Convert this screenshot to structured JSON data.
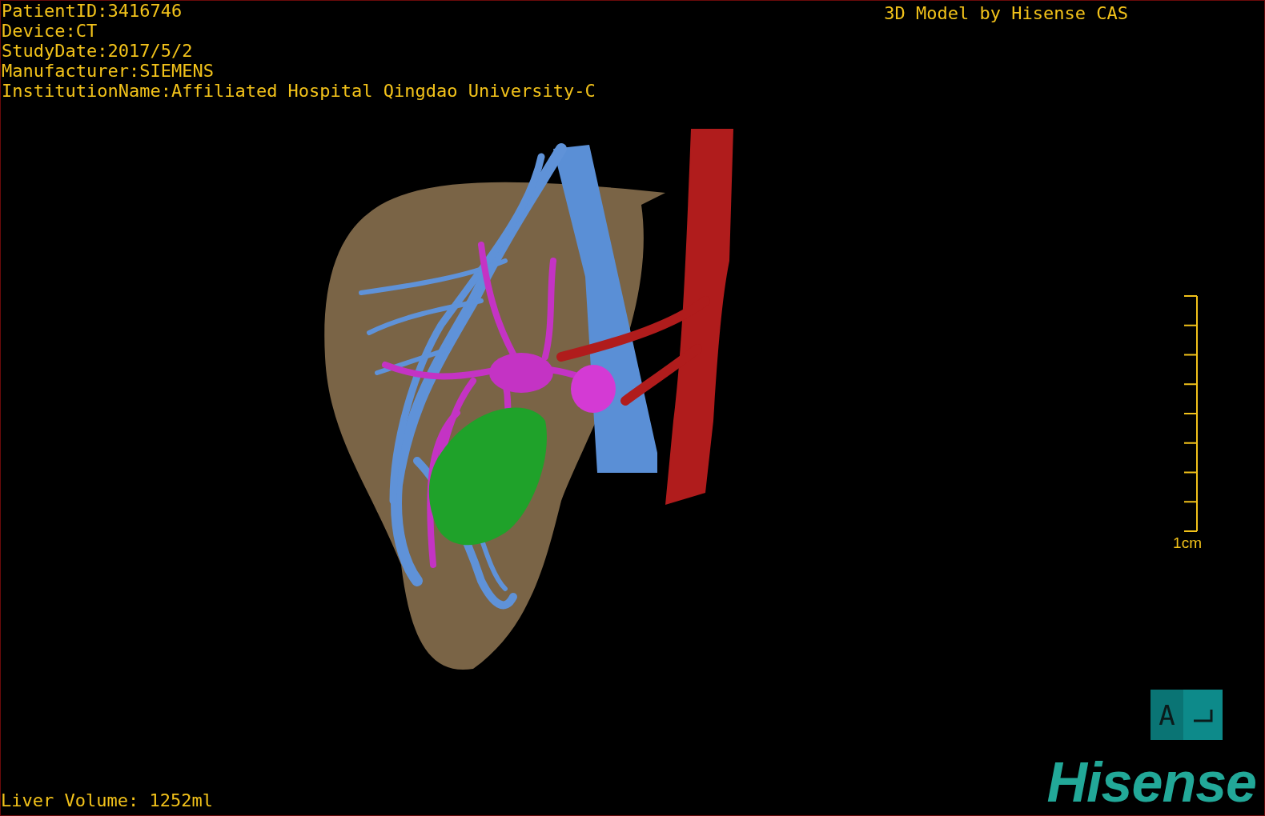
{
  "study_info": [
    "PatientID:3416746",
    "Device:CT",
    "StudyDate:2017/5/2",
    "Manufacturer:SIEMENS",
    "InstitutionName:Affiliated Hospital Qingdao University-C"
  ],
  "viewer_title": "3D Model by Hisense CAS",
  "scale_bar": {
    "label": "1cm"
  },
  "orientation_cube": {
    "label": "A"
  },
  "liver_volume": "Liver Volume: 1252ml",
  "logo": "Hisense"
}
